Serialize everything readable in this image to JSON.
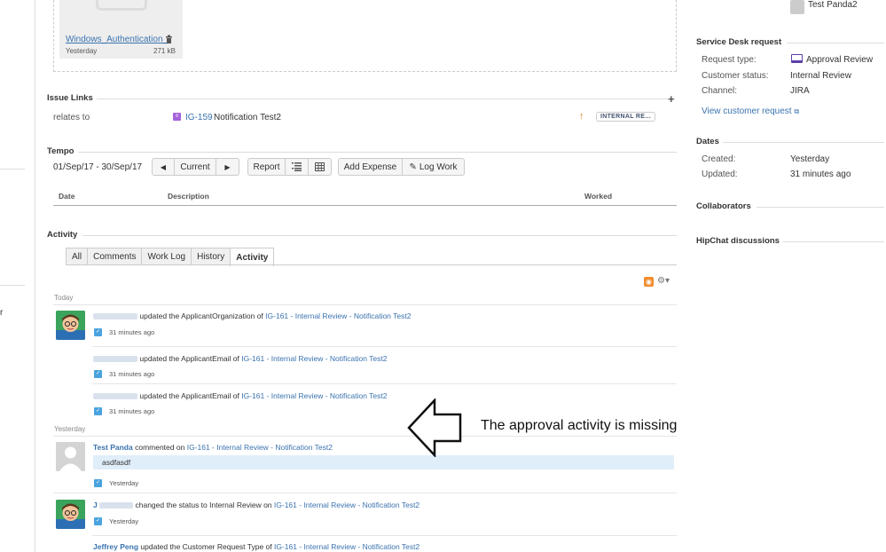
{
  "attachment": {
    "name": "Windows_Authentication_",
    "date": "Yesterday",
    "size": "271 kB"
  },
  "issue_links": {
    "heading": "Issue Links",
    "add_glyph": "+",
    "relation": "relates to",
    "issue_key": "IG-159",
    "issue_title": "Notification Test2",
    "priority_glyph": "↑",
    "status": "INTERNAL RE..."
  },
  "tempo": {
    "heading": "Tempo",
    "date_range": "01/Sep/17 - 30/Sep/17",
    "prev_glyph": "◀",
    "current_label": "Current",
    "next_glyph": "▶",
    "report_label": "Report",
    "add_expense_label": "Add Expense",
    "log_work_label": "Log Work",
    "columns": [
      "Date",
      "Description",
      "Worked"
    ]
  },
  "activity": {
    "heading": "Activity",
    "tabs": [
      "All",
      "Comments",
      "Work Log",
      "History",
      "Activity"
    ],
    "active_tab": "Activity",
    "groups": [
      {
        "label": "Today"
      },
      {
        "label": "Yesterday"
      }
    ],
    "entries": [
      {
        "actor": "",
        "action": "updated the ApplicantOrganization of",
        "link": "IG-161 - Internal Review - Notification Test2",
        "time": "31 minutes ago"
      },
      {
        "actor": "",
        "action": "updated the ApplicantEmail of",
        "link": "IG-161 - Internal Review - Notification Test2",
        "time": "31 minutes ago"
      },
      {
        "actor": "",
        "action": "updated the ApplicantEmail of",
        "link": "IG-161 - Internal Review - Notification Test2",
        "time": "31 minutes ago"
      },
      {
        "actor": "Test Panda",
        "action": "commented on",
        "link": "IG-161 - Internal Review - Notification Test2",
        "comment": "asdfasdf",
        "time": "Yesterday"
      },
      {
        "actor": "J",
        "action": "changed the status to Internal Review on",
        "link": "IG-161 - Internal Review - Notification Test2",
        "time": "Yesterday"
      },
      {
        "actor": "Jeffrey Peng",
        "action": "updated the Customer Request Type of",
        "link": "IG-161 - Internal Review - Notification Test2",
        "time": ""
      }
    ]
  },
  "sidebar": {
    "top_user": "Test Panda2",
    "service_desk": {
      "heading": "Service Desk request",
      "request_type_label": "Request type:",
      "request_type_value": "Approval Review",
      "customer_status_label": "Customer status:",
      "customer_status_value": "Internal Review",
      "channel_label": "Channel:",
      "channel_value": "JIRA",
      "view_link": "View customer request"
    },
    "dates": {
      "heading": "Dates",
      "created_label": "Created:",
      "created_value": "Yesterday",
      "updated_label": "Updated:",
      "updated_value": "31 minutes ago"
    },
    "collaborators_heading": "Collaborators",
    "hipchat_heading": "HipChat discussions"
  },
  "annotation": {
    "text": "The approval activity is missing"
  },
  "left_stub": "r",
  "colors": {
    "link": "#3b73af",
    "avatar_blue": "#4aa3df",
    "rss": "#f28b2c",
    "priority": "#e07b1f"
  }
}
